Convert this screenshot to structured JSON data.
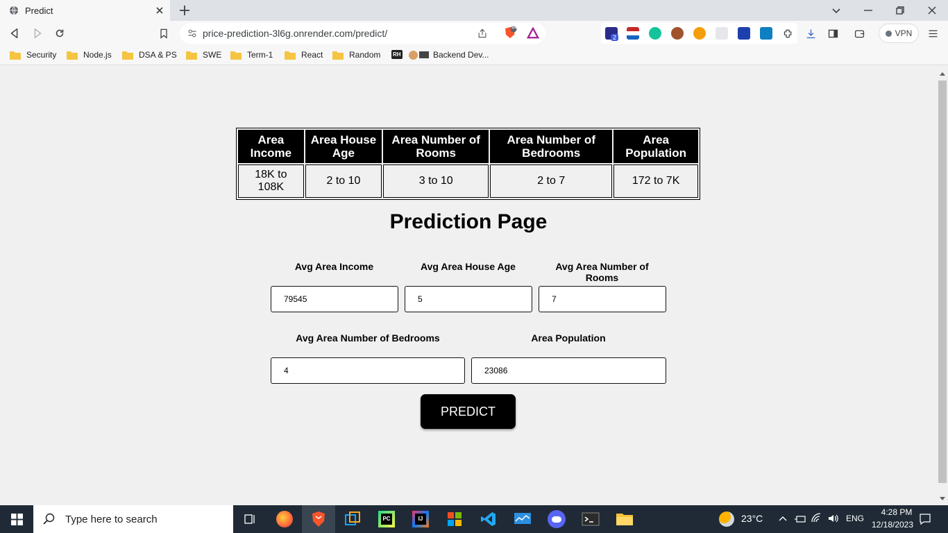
{
  "browser": {
    "tab_title": "Predict",
    "url": "price-prediction-3l6g.onrender.com/predict/",
    "vpn_label": "VPN",
    "brave_shield_count": "10",
    "extension_badge": "2",
    "bookmarks": [
      {
        "label": "Security"
      },
      {
        "label": "Node.js"
      },
      {
        "label": "DSA & PS"
      },
      {
        "label": "SWE"
      },
      {
        "label": "Term-1"
      },
      {
        "label": "React"
      },
      {
        "label": "Random"
      },
      {
        "label": "Backend Dev..."
      }
    ],
    "bookmark_rh_badge": "RH"
  },
  "ranges_table": {
    "headers": [
      "Area Income",
      "Area House Age",
      "Area Number of Rooms",
      "Area Number of Bedrooms",
      "Area Population"
    ],
    "values": [
      "18K to 108K",
      "2 to 10",
      "3 to 10",
      "2 to 7",
      "172 to 7K"
    ]
  },
  "form": {
    "title": "Prediction Page",
    "fields": [
      {
        "label": "Avg Area Income",
        "value": "79545"
      },
      {
        "label": "Avg Area House Age",
        "value": "5"
      },
      {
        "label": "Avg Area Number of Rooms",
        "value": "7"
      },
      {
        "label": "Avg Area Number of Bedrooms",
        "value": "4"
      },
      {
        "label": "Area Population",
        "value": "23086"
      }
    ],
    "submit_label": "PREDICT"
  },
  "taskbar": {
    "search_placeholder": "Type here to search",
    "weather": "23°C",
    "language": "ENG",
    "time": "4:28 PM",
    "date": "12/18/2023"
  }
}
